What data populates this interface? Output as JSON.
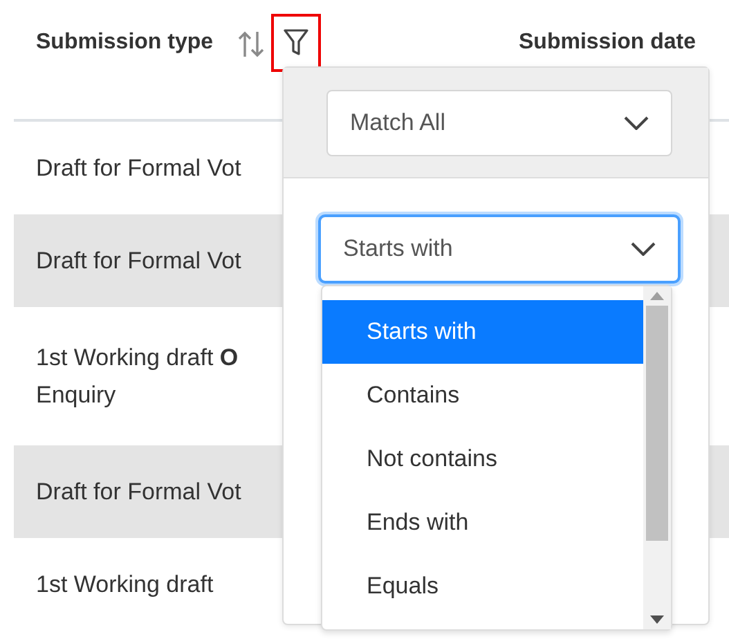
{
  "table": {
    "columns": [
      {
        "label": "Submission type",
        "sortable": true,
        "filter_highlighted": true
      },
      {
        "label": "Submission date"
      }
    ],
    "rows": [
      {
        "lines": [
          "Draft for Formal Vot"
        ]
      },
      {
        "lines": [
          "Draft for Formal Vot"
        ]
      },
      {
        "lines": [
          "1st Working draft **O**",
          "Enquiry"
        ]
      },
      {
        "lines": [
          "Draft for Formal Vot"
        ]
      },
      {
        "lines": [
          "1st Working draft"
        ]
      }
    ]
  },
  "filter_menu": {
    "match_mode": "Match All",
    "rule_mode": "Starts with",
    "options": [
      {
        "label": "Starts with",
        "selected": true
      },
      {
        "label": "Contains",
        "selected": false
      },
      {
        "label": "Not contains",
        "selected": false
      },
      {
        "label": "Ends with",
        "selected": false
      },
      {
        "label": "Equals",
        "selected": false
      }
    ]
  }
}
